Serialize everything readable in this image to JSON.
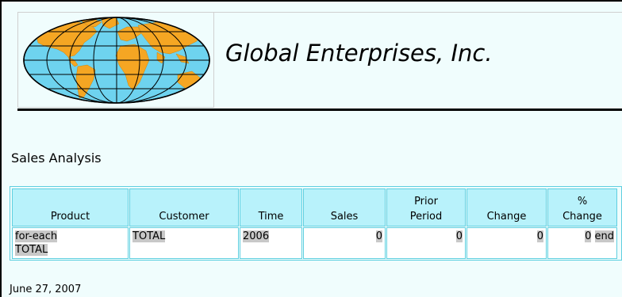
{
  "header": {
    "company_name": "Global Enterprises, Inc."
  },
  "report": {
    "title": "Sales Analysis",
    "columns": [
      {
        "line1": "",
        "line2": "Product"
      },
      {
        "line1": "",
        "line2": "Customer"
      },
      {
        "line1": "",
        "line2": "Time"
      },
      {
        "line1": "",
        "line2": "Sales"
      },
      {
        "line1": "Prior",
        "line2": "Period"
      },
      {
        "line1": "",
        "line2": "Change"
      },
      {
        "line1": "%",
        "line2": "Change"
      }
    ],
    "row": {
      "product_1": "for-each",
      "product_2": "TOTAL",
      "customer": "TOTAL",
      "time": "2006",
      "sales": "0",
      "prior_period": "0",
      "change": "0",
      "pct_change": "0",
      "end_marker": "end"
    }
  },
  "footer": {
    "date": "June 27, 2007"
  },
  "colors": {
    "background": "#f0fdfd",
    "header_cell": "#b8f2fb",
    "cell_border": "#5fcfe0",
    "highlight": "#c8c8c8",
    "globe_water": "#6ed3ef",
    "globe_land": "#f5a623"
  },
  "icons": {
    "logo": "world-map-globe-icon"
  }
}
